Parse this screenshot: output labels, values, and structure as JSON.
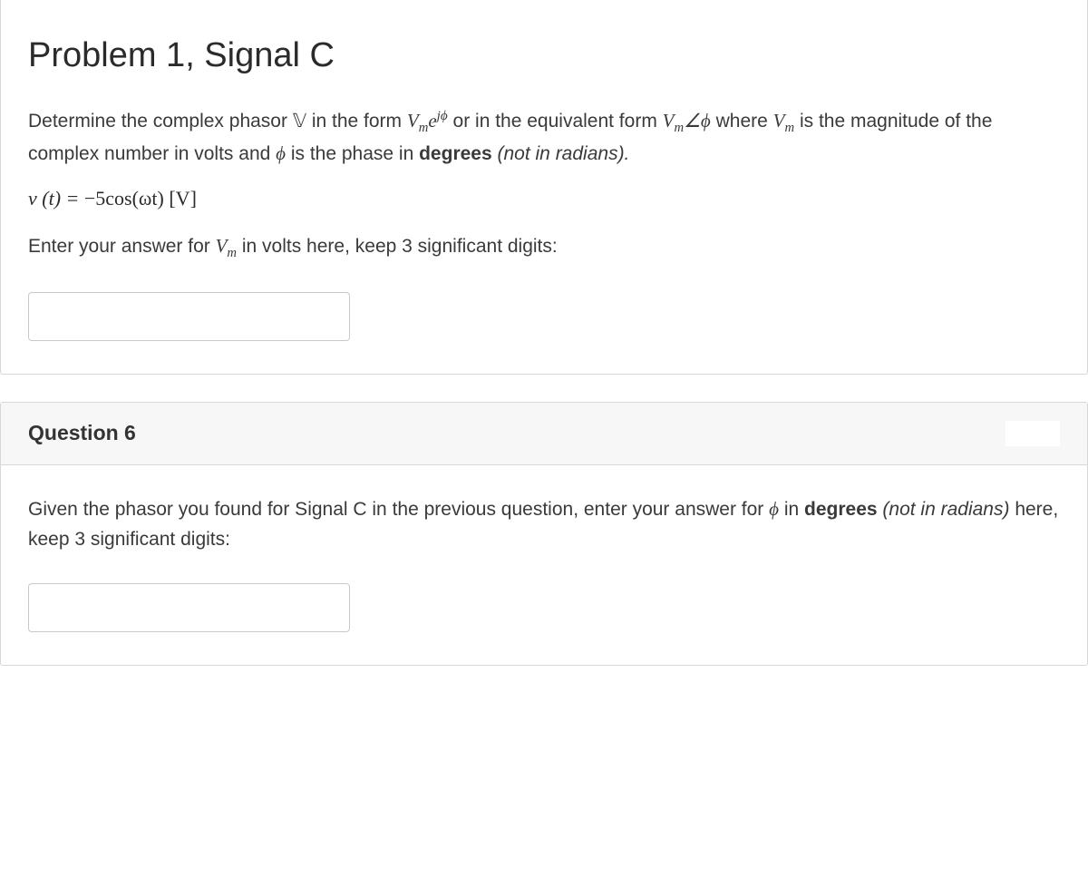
{
  "q5": {
    "title": "Problem 1, Signal C",
    "intro_a": "Determine the complex phasor ",
    "intro_b": " in the form ",
    "intro_c": " or in the equivalent form ",
    "intro_d": " where ",
    "intro_e": " is the magnitude of the complex number in volts and ",
    "intro_f": " is the phase in ",
    "degrees_word": "degrees",
    "not_radians": " (not in radians).",
    "equation_lhs": "v (t) = ",
    "equation_rhs": "−5cos(ωt)   [V]",
    "prompt_a": "Enter your answer for ",
    "prompt_b": " in volts here, keep 3 significant digits:"
  },
  "q6": {
    "header": "Question 6",
    "prompt_a": "Given the phasor you found for Signal C in the previous question, enter your answer for ",
    "prompt_b": " in ",
    "degrees_word": "degrees",
    "not_radians": " (not in radians)",
    "prompt_c": " here, keep 3 significant digits:"
  },
  "math": {
    "V_ds": "𝕍",
    "Vm": "V",
    "m_sub": "m",
    "e": "e",
    "jphi_sup": "jϕ",
    "angle": "∠",
    "phi": "ϕ"
  }
}
